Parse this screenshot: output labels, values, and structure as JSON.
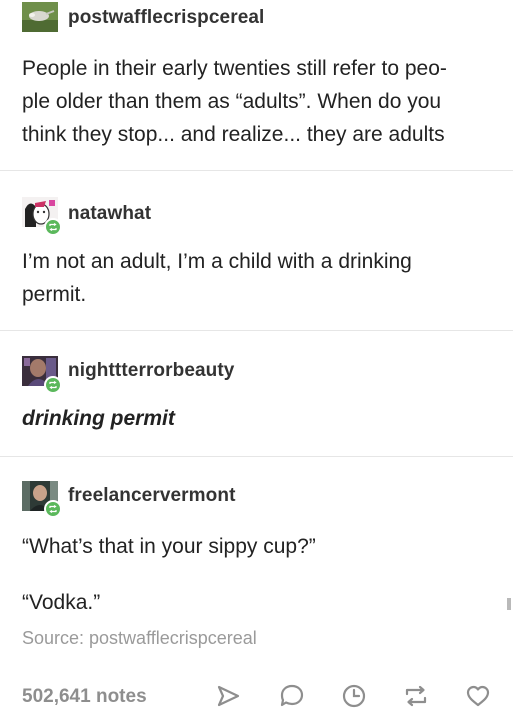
{
  "posts": [
    {
      "username": "postwafflecrispcereal",
      "lines": [
        "People in their early twenties still refer to peo-",
        "ple older than them as “adults”. When do you",
        "think they stop... and realize... they are adults"
      ]
    },
    {
      "username": "natawhat",
      "lines": [
        "I’m not an adult, I’m a child with a drinking",
        "permit."
      ]
    },
    {
      "username": "nighttterrorbeauty",
      "lines": [
        "drinking permit"
      ]
    },
    {
      "username": "freelancervermont",
      "lines": [
        "“What’s that in your sippy cup?”",
        "“Vodka.”"
      ]
    }
  ],
  "source": "Source: postwafflecrispcereal",
  "footer": {
    "notes": "502,641 notes",
    "icons": [
      "share-icon",
      "reply-icon",
      "queue-icon",
      "reblog-icon",
      "like-icon"
    ]
  },
  "colors": {
    "reblog_badge": "#5bb85c",
    "muted_text": "#8e8e8e",
    "divider": "#e6e6e6"
  }
}
